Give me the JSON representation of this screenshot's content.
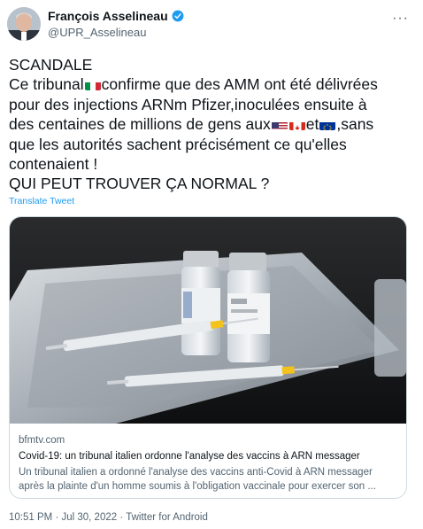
{
  "user": {
    "name": "François Asselineau",
    "handle": "@UPR_Asselineau"
  },
  "tweet": {
    "line1": "SCANDALE",
    "line2a": "Ce tribunal",
    "line2b": "confirme que des AMM ont été délivrées",
    "line3": "pour des injections ARNm Pfizer,inoculées ensuite à",
    "line4a": "des centaines de millions de gens aux",
    "line4b": "et",
    "line4c": ",sans",
    "line5": "que les autorités sachent précisément ce qu'elles",
    "line6": "contenaient !",
    "line7": "QUI PEUT TROUVER ÇA NORMAL ?",
    "translate_label": "Translate Tweet",
    "flags": [
      "italy-flag-icon",
      "usa-flag-icon",
      "canada-flag-icon",
      "eu-flag-icon"
    ]
  },
  "card": {
    "domain": "bfmtv.com",
    "title": "Covid-19: un tribunal italien ordonne l'analyse des vaccins à ARN messager",
    "desc1": "Un tribunal italien a ordonné l'analyse des vaccins anti-Covid à ARN messager",
    "desc2": "après la plainte d'un homme soumis à l'obligation vaccinale pour exercer son ..."
  },
  "footer": {
    "time": "10:51 PM",
    "date": "Jul 30, 2022",
    "source": "Twitter for Android",
    "separator": "·"
  },
  "colors": {
    "link": "#1d9bf0",
    "secondary": "#536471",
    "verified": "#1d9bf0"
  }
}
